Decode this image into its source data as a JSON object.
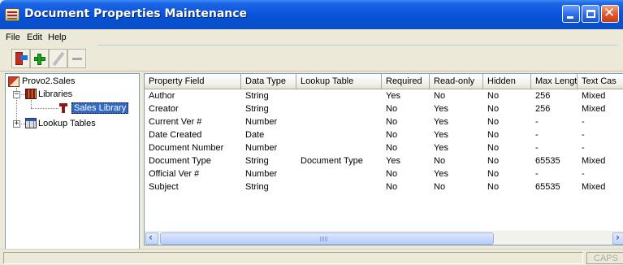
{
  "window": {
    "title": "Document Properties Maintenance"
  },
  "menu": [
    "File",
    "Edit",
    "Help"
  ],
  "toolbar": {
    "buttons": [
      "exit-icon",
      "add-icon",
      "edit-icon",
      "delete-icon"
    ]
  },
  "tree": {
    "root": "Provo2.Sales",
    "libraries": "Libraries",
    "selected_library": "Sales Library",
    "lookup_tables": "Lookup Tables"
  },
  "grid": {
    "columns": [
      "Property Field",
      "Data Type",
      "Lookup Table",
      "Required",
      "Read-only",
      "Hidden",
      "Max Lengtl",
      "Text Cas"
    ],
    "rows": [
      [
        "Author",
        "String",
        "",
        "Yes",
        "No",
        "No",
        "256",
        "Mixed"
      ],
      [
        "Creator",
        "String",
        "",
        "No",
        "Yes",
        "No",
        "256",
        "Mixed"
      ],
      [
        "Current Ver #",
        "Number",
        "",
        "No",
        "Yes",
        "No",
        "-",
        "-"
      ],
      [
        "Date Created",
        "Date",
        "",
        "No",
        "Yes",
        "No",
        "-",
        "-"
      ],
      [
        "Document Number",
        "Number",
        "",
        "No",
        "Yes",
        "No",
        "-",
        "-"
      ],
      [
        "Document Type",
        "String",
        "Document Type",
        "Yes",
        "No",
        "No",
        "65535",
        "Mixed"
      ],
      [
        "Official Ver #",
        "Number",
        "",
        "No",
        "Yes",
        "No",
        "-",
        "-"
      ],
      [
        "Subject",
        "String",
        "",
        "No",
        "No",
        "No",
        "65535",
        "Mixed"
      ]
    ]
  },
  "status": {
    "message": "",
    "caps": "CAPS"
  },
  "colors": {
    "titlebar": "#0a55dc",
    "selection": "#316ac5",
    "window_face": "#ece9d8"
  }
}
